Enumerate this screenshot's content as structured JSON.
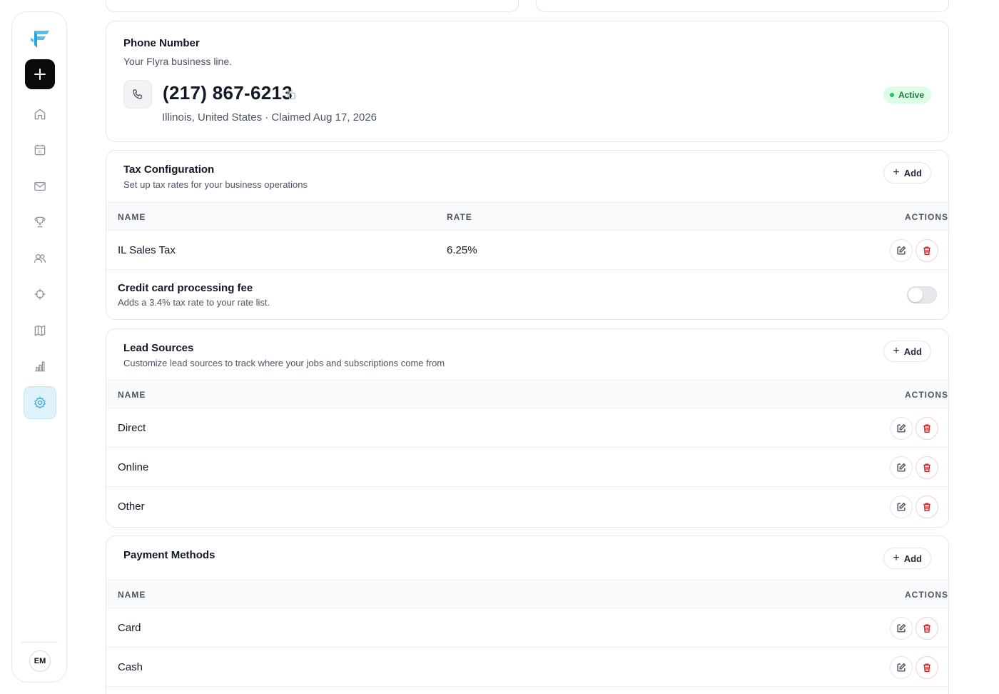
{
  "sidebar": {
    "new_label": "+",
    "nav": [
      {
        "icon": "home-icon"
      },
      {
        "icon": "calendar-icon"
      },
      {
        "icon": "mail-icon"
      },
      {
        "icon": "trophy-icon"
      },
      {
        "icon": "users-icon"
      },
      {
        "icon": "crosshair-icon"
      },
      {
        "icon": "map-icon"
      },
      {
        "icon": "bar-chart-icon"
      },
      {
        "icon": "settings-icon",
        "active": true
      }
    ],
    "calendar_day": "31",
    "avatar_initials": "EM"
  },
  "phone": {
    "title": "Phone Number",
    "subtitle": "Your Flyra business line.",
    "number": "(217) 867-6213",
    "meta": "Illinois, United States · Claimed Aug 17, 2026",
    "status": "Active",
    "status_color": "#15803d"
  },
  "tax": {
    "title": "Tax Configuration",
    "subtitle": "Set up tax rates for your business operations",
    "add_label": "Add",
    "columns": {
      "name": "NAME",
      "rate": "RATE",
      "actions": "ACTIONS"
    },
    "rows": [
      {
        "name": "IL Sales Tax",
        "rate": "6.25%"
      }
    ],
    "fee": {
      "title": "Credit card processing fee",
      "description": "Adds a 3.4% tax rate to your rate list.",
      "enabled": false
    }
  },
  "lead_sources": {
    "title": "Lead Sources",
    "subtitle": "Customize lead sources to track where your jobs and subscriptions come from",
    "add_label": "Add",
    "columns": {
      "name": "NAME",
      "actions": "ACTIONS"
    },
    "rows": [
      {
        "name": "Direct"
      },
      {
        "name": "Online"
      },
      {
        "name": "Other"
      }
    ]
  },
  "payment_methods": {
    "title": "Payment Methods",
    "add_label": "Add",
    "columns": {
      "name": "NAME",
      "actions": "ACTIONS"
    },
    "rows": [
      {
        "name": "Card"
      },
      {
        "name": "Cash"
      }
    ]
  },
  "colors": {
    "accent": "#3aa7d6",
    "danger": "#dc2626",
    "active_badge_bg": "#dcfce7"
  }
}
